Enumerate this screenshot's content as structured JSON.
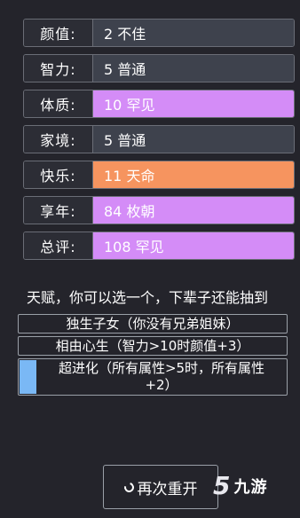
{
  "stats": [
    {
      "label": "颜值:",
      "value": "2 不佳",
      "tier": "normal"
    },
    {
      "label": "智力:",
      "value": "5 普通",
      "tier": "normal"
    },
    {
      "label": "体质:",
      "value": "10 罕见",
      "tier": "rare"
    },
    {
      "label": "家境:",
      "value": "5 普通",
      "tier": "normal"
    },
    {
      "label": "快乐:",
      "value": "11 天命",
      "tier": "fate"
    },
    {
      "label": "享年:",
      "value": "84 枚朝",
      "tier": "rare"
    },
    {
      "label": "总评:",
      "value": "108 罕见",
      "tier": "rare"
    }
  ],
  "talents": {
    "title": "天赋，你可以选一个，下辈子还能抽到",
    "items": [
      {
        "label": "独生子女（你没有兄弟姐妹）"
      },
      {
        "label": "相由心生（智力>10时颜值+3）"
      },
      {
        "label_line1": "超进化（所有属性>5时，所有属性",
        "label_line2": "+2）"
      }
    ]
  },
  "restart": {
    "label": "再次重开",
    "icon": "refresh-icon"
  },
  "watermark": {
    "logo_mark": "5",
    "text": "九游"
  },
  "colors": {
    "background": "#24242b",
    "label_bg": "#2c2d35",
    "value_normal": "#3e424d",
    "value_rare": "#d48cf7",
    "value_fate": "#f6945f",
    "talent_selected": "#7ab8f5"
  }
}
